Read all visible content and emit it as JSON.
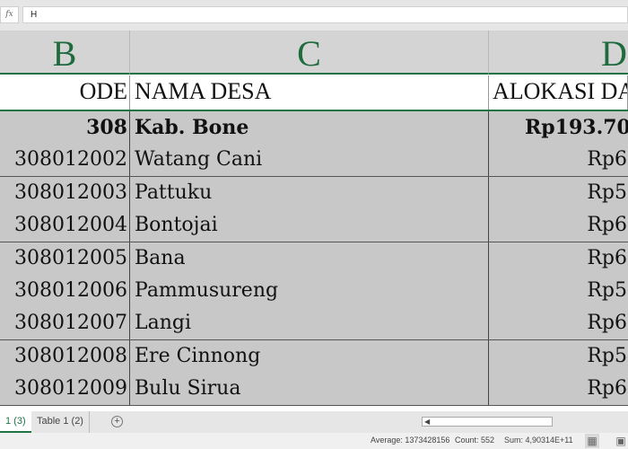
{
  "formula_bar": {
    "fx_label": "fx",
    "value": "H"
  },
  "columns": [
    "B",
    "C",
    "D"
  ],
  "header": {
    "kode": "ODE",
    "nama": "NAMA DESA",
    "alokasi": "ALOKASI DA"
  },
  "rows": [
    {
      "kode": "308",
      "nama": "Kab.  Bone",
      "alokasi": "Rp193.70",
      "bold": true
    },
    {
      "kode": "308012002",
      "nama": "Watang  Cani",
      "alokasi": "Rp6"
    },
    {
      "kode": "308012003",
      "nama": "Pattuku",
      "alokasi": "Rp5"
    },
    {
      "kode": "308012004",
      "nama": "Bontojai",
      "alokasi": "Rp6"
    },
    {
      "kode": "308012005",
      "nama": "Bana",
      "alokasi": "Rp6"
    },
    {
      "kode": "308012006",
      "nama": "Pammusureng",
      "alokasi": "Rp5"
    },
    {
      "kode": "308012007",
      "nama": "Langi",
      "alokasi": "Rp6"
    },
    {
      "kode": "308012008",
      "nama": "Ere Cinnong",
      "alokasi": "Rp5"
    },
    {
      "kode": "308012009",
      "nama": "Bulu Sirua",
      "alokasi": "Rp6"
    }
  ],
  "sheet_tabs": [
    {
      "label": "1 (3)",
      "active": true
    },
    {
      "label": "Table 1 (2)",
      "active": false
    }
  ],
  "add_sheet": "+",
  "status": {
    "average": "Average: 1373428156",
    "count": "Count: 552",
    "sum": "Sum: 4,90314E+11"
  },
  "colors": {
    "accent": "#217346"
  }
}
